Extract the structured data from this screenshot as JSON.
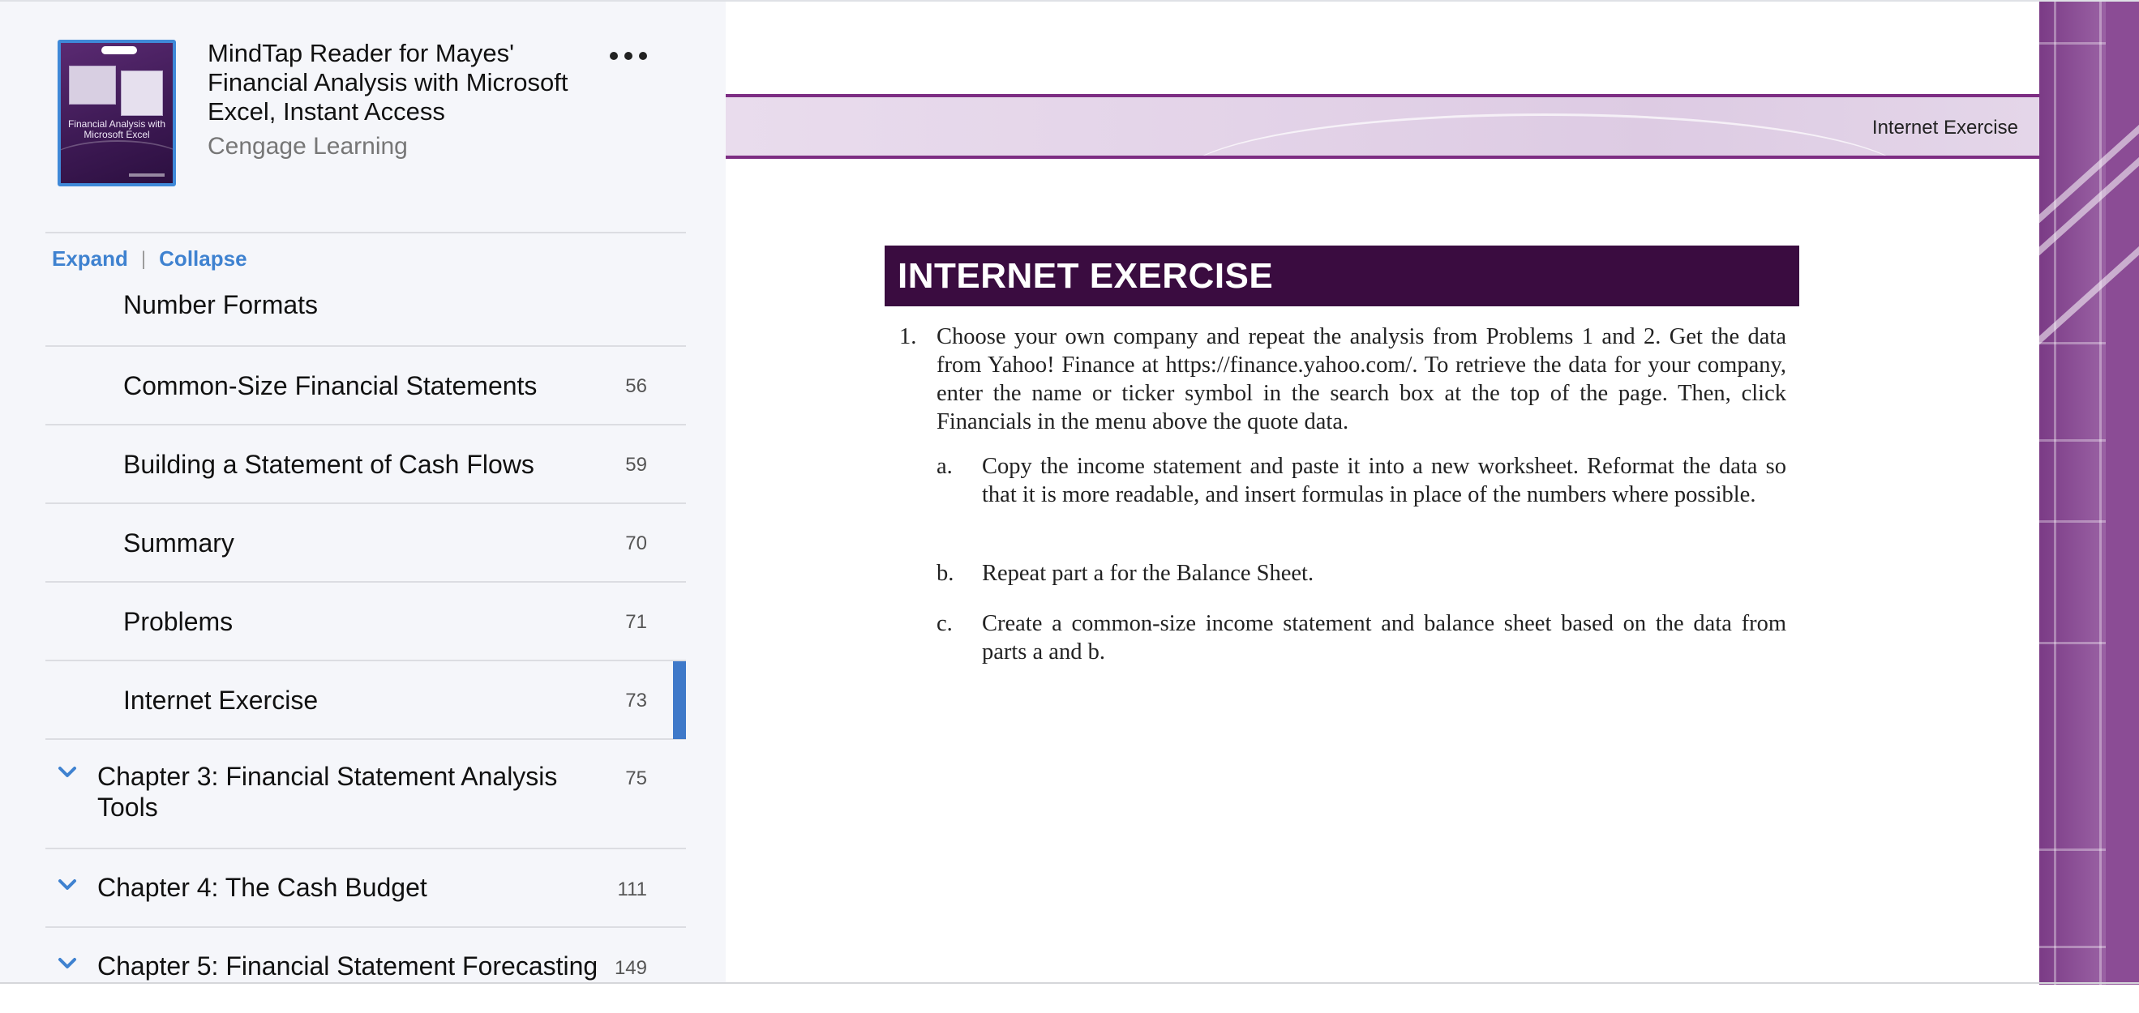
{
  "book": {
    "title": "MindTap Reader for Mayes' Financial Analysis with Microsoft Excel, Instant Access",
    "publisher": "Cengage Learning",
    "cover_title": "Financial Analysis with Microsoft Excel",
    "more_icon": "more-horizontal-icon"
  },
  "toc_controls": {
    "expand": "Expand",
    "separator": "|",
    "collapse": "Collapse"
  },
  "toc": {
    "items": [
      {
        "label": "Number Formats",
        "page": ""
      },
      {
        "label": "Common-Size Financial Statements",
        "page": "56"
      },
      {
        "label": "Building a Statement of Cash Flows",
        "page": "59"
      },
      {
        "label": "Summary",
        "page": "70"
      },
      {
        "label": "Problems",
        "page": "71"
      },
      {
        "label": "Internet Exercise",
        "page": "73",
        "active": true
      }
    ],
    "chapters": [
      {
        "label": "Chapter 3: Financial Statement Analysis Tools",
        "page": "75",
        "icon": "chevron-down-icon"
      },
      {
        "label": "Chapter 4: The Cash Budget",
        "page": "111",
        "icon": "chevron-down-icon"
      },
      {
        "label": "Chapter 5: Financial Statement Forecasting",
        "page": "149",
        "icon": "chevron-down-icon"
      }
    ]
  },
  "page": {
    "running_header": "Internet Exercise",
    "section_heading": "INTERNET EXERCISE",
    "question": {
      "number": "1.",
      "text": "Choose your own company and repeat the analysis from Problems 1 and 2. Get the data from Yahoo! Finance at https://finance.yahoo.com/. To retrieve the data for your company, enter the name or ticker symbol in the search box at the top of the page. Then, click Financials in the menu above the quote data.",
      "parts": [
        {
          "letter": "a.",
          "text": "Copy the income statement and paste it into a new worksheet. Reformat the data so that it is more readable, and insert formulas in place of the numbers where possible."
        },
        {
          "letter": "b.",
          "text": "Repeat part a for the Balance Sheet."
        },
        {
          "letter": "c.",
          "text": "Create a common-size income statement and balance sheet based on the data from parts a and b."
        }
      ]
    }
  },
  "colors": {
    "accent_blue": "#3f82d0",
    "active_bar": "#3f79c9",
    "heading_bg": "#3a0c40",
    "band_border": "#7d2d83",
    "strip_purple": "#8b4c95"
  }
}
